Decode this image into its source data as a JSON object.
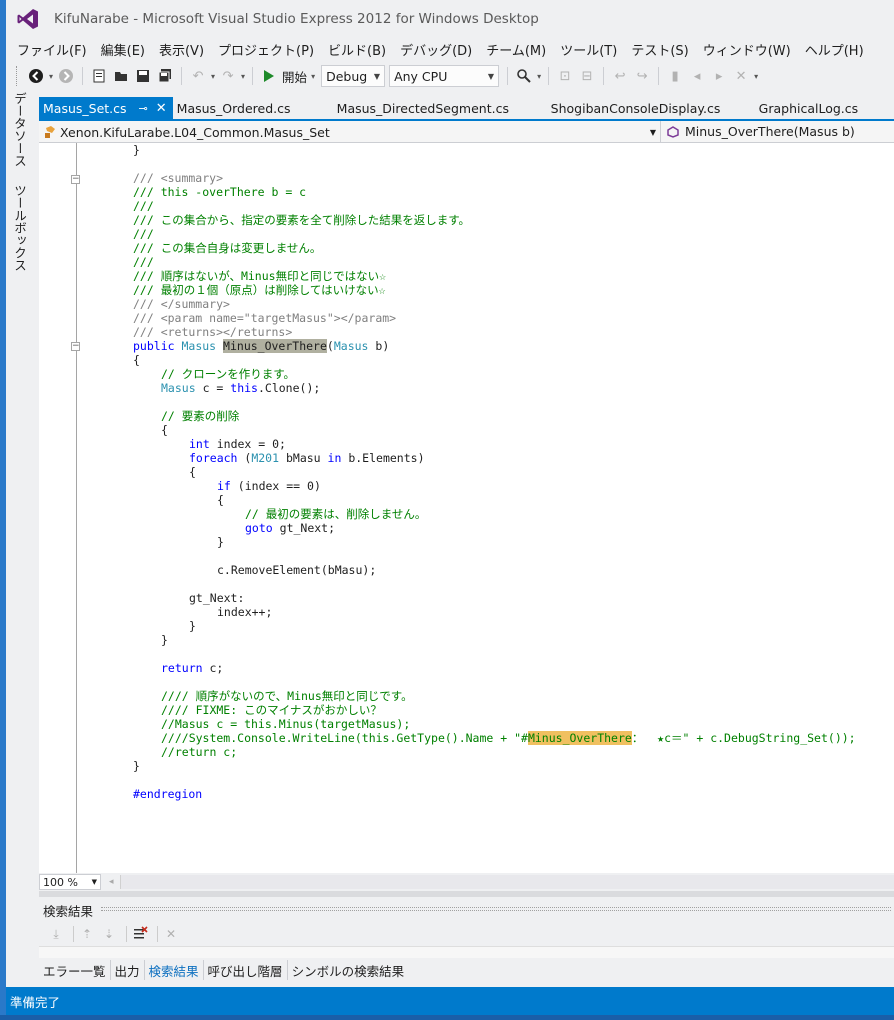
{
  "window": {
    "title": "KifuNarabe - Microsoft Visual Studio Express 2012 for Windows Desktop"
  },
  "menu": [
    "ファイル(F)",
    "編集(E)",
    "表示(V)",
    "プロジェクト(P)",
    "ビルド(B)",
    "デバッグ(D)",
    "チーム(M)",
    "ツール(T)",
    "テスト(S)",
    "ウィンドウ(W)",
    "ヘルプ(H)"
  ],
  "toolbar": {
    "start_label": "開始",
    "config": "Debug",
    "platform": "Any CPU"
  },
  "side_tabs": [
    "データソース",
    "ツールボックス"
  ],
  "doc_tabs": [
    "Masus_Set.cs",
    "Masus_Ordered.cs",
    "Masus_DirectedSegment.cs",
    "ShogibanConsoleDisplay.cs",
    "GraphicalLog.cs"
  ],
  "nav": {
    "type": "Xenon.KifuLarabe.L04_Common.Masus_Set",
    "member": "Minus_OverThere(Masus b)"
  },
  "code": {
    "l0": "}",
    "l1": "/// <summary>",
    "l2": "/// this -overThere b = c",
    "l3": "///",
    "l4": "/// この集合から、指定の要素を全て削除した結果を返します。",
    "l5": "///",
    "l6": "/// この集合自身は変更しません。",
    "l7": "///",
    "l8": "/// 順序はないが、Minus無印と同じではない☆",
    "l9": "/// 最初の１個（原点）は削除してはいけない☆",
    "l10": "/// </summary>",
    "l11": "/// <param name=\"targetMasus\"></param>",
    "l12": "/// <returns></returns>",
    "l13_kw": "public",
    "l13_type": "Masus",
    "l13_name": "Minus_OverThere",
    "l13_ptype": "Masus",
    "l13_rest": "b)",
    "l14": "{",
    "l15": "// クローンを作ります。",
    "l16_type": "Masus",
    "l16_mid": "c =",
    "l16_kw": "this",
    "l16_rest": ".Clone();",
    "l17": "// 要素の削除",
    "l18": "{",
    "l19_kw": "int",
    "l19_rest": "index = 0;",
    "l20_kw": "foreach",
    "l20_type": "M201",
    "l20_mid": "bMasu",
    "l20_kw2": "in",
    "l20_rest": "b.Elements)",
    "l21": "{",
    "l22_kw": "if",
    "l22_rest": "(index == 0)",
    "l23": "{",
    "l24": "// 最初の要素は、削除しません。",
    "l25_kw": "goto",
    "l25_rest": "gt_Next;",
    "l26": "}",
    "l27": "c.RemoveElement(bMasu);",
    "l28": "gt_Next:",
    "l29": "index++;",
    "l30": "}",
    "l31": "}",
    "l32_kw": "return",
    "l32_rest": "c;",
    "l33": "//// 順序がないので、Minus無印と同じです。",
    "l34": "//// FIXME: このマイナスがおかしい？",
    "l35": "//Masus c = this.Minus(targetMasus);",
    "l36_a": "////System.Console.WriteLine(this.GetType().Name + \"#",
    "l36_hl": "Minus_OverThere",
    "l36_b": "：  ★c＝\" + c.DebugString_Set());",
    "l37": "//return c;",
    "l38": "}",
    "l39": "#endregion"
  },
  "zoom": "100 %",
  "panel": {
    "title": "検索結果"
  },
  "bottom_tabs": [
    "エラー一覧",
    "出力",
    "検索結果",
    "呼び出し階層",
    "シンボルの検索結果"
  ],
  "status": "準備完了"
}
